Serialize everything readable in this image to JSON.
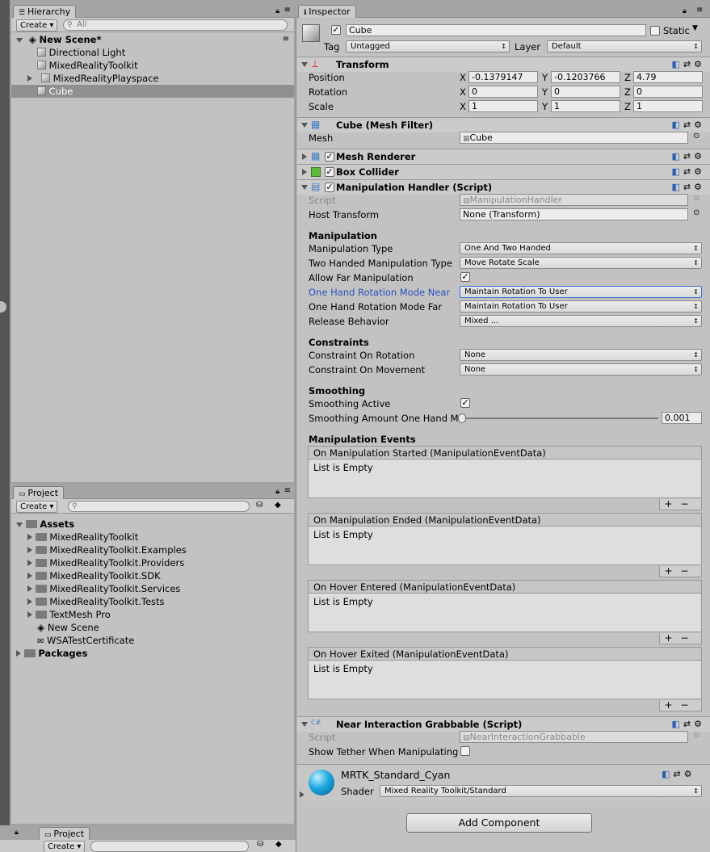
{
  "hierarchy": {
    "tab_label": "Hierarchy",
    "create_label": "Create",
    "search_placeholder": "All",
    "scene_name": "New Scene*",
    "items": [
      {
        "label": "Directional Light"
      },
      {
        "label": "MixedRealityToolkit"
      },
      {
        "label": "MixedRealityPlayspace"
      },
      {
        "label": "Cube"
      }
    ]
  },
  "project": {
    "tab_label": "Project",
    "create_label": "Create",
    "assets_label": "Assets",
    "items": [
      {
        "label": "MixedRealityToolkit"
      },
      {
        "label": "MixedRealityToolkit.Examples"
      },
      {
        "label": "MixedRealityToolkit.Providers"
      },
      {
        "label": "MixedRealityToolkit.SDK"
      },
      {
        "label": "MixedRealityToolkit.Services"
      },
      {
        "label": "MixedRealityToolkit.Tests"
      },
      {
        "label": "TextMesh Pro"
      },
      {
        "label": "New Scene"
      },
      {
        "label": "WSATestCertificate"
      }
    ],
    "packages_label": "Packages"
  },
  "bottom_project": {
    "tab_label": "Project",
    "create_label": "Create"
  },
  "inspector": {
    "tab_label": "Inspector",
    "object_name": "Cube",
    "static_label": "Static",
    "tag_label": "Tag",
    "tag_value": "Untagged",
    "layer_label": "Layer",
    "layer_value": "Default",
    "transform": {
      "title": "Transform",
      "position_label": "Position",
      "rotation_label": "Rotation",
      "scale_label": "Scale",
      "position": {
        "x": "-0.1379147",
        "y": "-0.1203766",
        "z": "4.79"
      },
      "rotation": {
        "x": "0",
        "y": "0",
        "z": "0"
      },
      "scale": {
        "x": "1",
        "y": "1",
        "z": "1"
      },
      "x": "X",
      "y": "Y",
      "z": "Z"
    },
    "mesh_filter": {
      "title": "Cube (Mesh Filter)",
      "mesh_label": "Mesh",
      "mesh_value": "Cube"
    },
    "mesh_renderer": {
      "title": "Mesh Renderer"
    },
    "box_collider": {
      "title": "Box Collider"
    },
    "manipulation_handler": {
      "title": "Manipulation Handler (Script)",
      "script_label": "Script",
      "script_value": "ManipulationHandler",
      "host_transform_label": "Host Transform",
      "host_transform_value": "None (Transform)",
      "manipulation_header": "Manipulation",
      "manipulation_type_label": "Manipulation Type",
      "manipulation_type_value": "One And Two Handed",
      "two_handed_label": "Two Handed Manipulation Type",
      "two_handed_value": "Move Rotate Scale",
      "allow_far_label": "Allow Far Manipulation",
      "rotation_near_label": "One Hand Rotation Mode Near",
      "rotation_near_value": "Maintain Rotation To User",
      "rotation_far_label": "One Hand Rotation Mode Far",
      "rotation_far_value": "Maintain Rotation To User",
      "release_label": "Release Behavior",
      "release_value": "Mixed ...",
      "constraints_header": "Constraints",
      "constraint_rotation_label": "Constraint On Rotation",
      "constraint_rotation_value": "None",
      "constraint_movement_label": "Constraint On Movement",
      "constraint_movement_value": "None",
      "smoothing_header": "Smoothing",
      "smoothing_active_label": "Smoothing Active",
      "smoothing_amount_label": "Smoothing Amount One Hand Ma",
      "smoothing_amount_value": "0.001",
      "events_header": "Manipulation Events",
      "events": [
        {
          "title": "On Manipulation Started (ManipulationEventData)",
          "body": "List is Empty"
        },
        {
          "title": "On Manipulation Ended (ManipulationEventData)",
          "body": "List is Empty"
        },
        {
          "title": "On Hover Entered (ManipulationEventData)",
          "body": "List is Empty"
        },
        {
          "title": "On Hover Exited (ManipulationEventData)",
          "body": "List is Empty"
        }
      ]
    },
    "near_interaction": {
      "title": "Near Interaction Grabbable (Script)",
      "script_label": "Script",
      "script_value": "NearInteractionGrabbable",
      "tether_label": "Show Tether When Manipulating"
    },
    "material": {
      "name": "MRTK_Standard_Cyan",
      "shader_label": "Shader",
      "shader_value": "Mixed Reality Toolkit/Standard",
      "sphere_color": "#1ba7e0"
    },
    "add_component_label": "Add Component"
  },
  "colors": {
    "selection": "#8f8f8f",
    "highlight_label": "#2a52be"
  }
}
